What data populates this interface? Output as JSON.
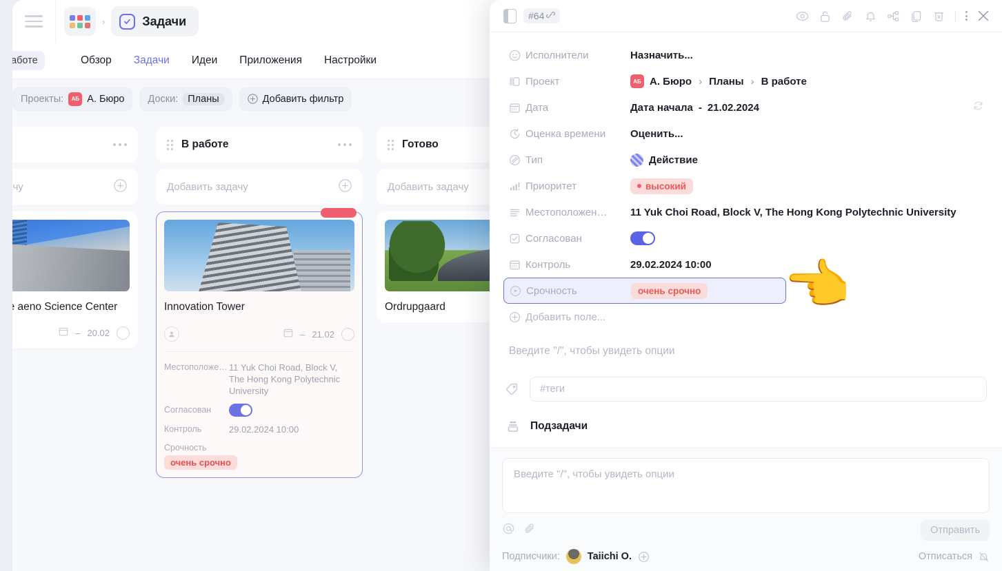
{
  "colors": {
    "accent": "#6b72e8",
    "danger": "#ef5f6e",
    "tag_bg": "#fbdcda",
    "tag_text": "#e0534f",
    "board_bg": "#f7f8fb",
    "muted": "#a8acbb"
  },
  "topbar": {
    "menu_icon": "hamburger-icon",
    "apps_icon": "apps-grid-icon",
    "apps_colors": [
      "#7b80e8",
      "#ef5f6e",
      "#57a8f0",
      "#f0bd6e",
      "#6fc79a",
      "#e3716e"
    ],
    "separator": "›",
    "breadcrumb_app": "Задачи",
    "check_icon": "check-circle-icon"
  },
  "nav": {
    "pill_label": "работе",
    "tabs": [
      {
        "label": "Обзор",
        "active": false
      },
      {
        "label": "Задачи",
        "active": true
      },
      {
        "label": "Идеи",
        "active": false
      },
      {
        "label": "Приложения",
        "active": false
      },
      {
        "label": "Настройки",
        "active": false
      }
    ]
  },
  "filters": {
    "projects_key": "Проекты:",
    "projects_avatar": "АБ",
    "projects_value": "А. Бюро",
    "boards_key": "Доски:",
    "boards_value": "Планы",
    "add_filter": "Добавить фильтр",
    "add_filter_icon": "plus-circle-icon"
  },
  "board": {
    "add_task_placeholder": "Добавить задачу",
    "add_task_placeholder_clipped": "чу",
    "columns": [
      {
        "title": "",
        "card": {
          "title": "маркетинговые\nаеno Science Center",
          "date": "20.02"
        }
      },
      {
        "title": "В работе",
        "card": {
          "title": "Innovation Tower",
          "date": "21.02",
          "fields": [
            {
              "key": "Местоположе…",
              "value": "11 Yuk Choi Road, Block V, The Hong Kong Polytechnic University",
              "type": "text"
            },
            {
              "key": "Согласован",
              "value": "on",
              "type": "toggle"
            },
            {
              "key": "Контроль",
              "value": "29.02.2024 10:00",
              "type": "text"
            },
            {
              "key": "Срочность",
              "value": "очень срочно",
              "type": "tag"
            }
          ]
        }
      },
      {
        "title": "Готово",
        "card": {
          "title": "Ordrupgaard",
          "date": ""
        }
      }
    ]
  },
  "panel": {
    "header": {
      "sidebar_icon": "panel-toggle-icon",
      "task_id": "#64",
      "link_icon": "link-icon",
      "actions": [
        "eye-icon",
        "lock-icon",
        "paperclip-icon",
        "bell-icon",
        "sitemap-icon",
        "copy-document-icon",
        "trash-icon"
      ],
      "kebab_icon": "more-vertical-icon",
      "close_icon": "close-icon"
    },
    "fields": [
      {
        "icon": "smiley-face-icon",
        "key": "Исполнители",
        "value": "Назначить...",
        "type": "placeholder"
      },
      {
        "icon": "project-board-icon",
        "key": "Проект",
        "type": "breadcrumb",
        "avatar": "АБ",
        "crumbs": [
          "А. Бюро",
          "Планы",
          "В работе"
        ],
        "crumb_sep": "›"
      },
      {
        "icon": "calendar-icon",
        "key": "Дата",
        "type": "date",
        "value_prefix": "Дата начала",
        "value_dash": "-",
        "value": "21.02.2024",
        "trailing_icon": "repeat-icon"
      },
      {
        "icon": "time-estimate-icon",
        "key": "Оценка времени",
        "value": "Оценить...",
        "type": "strong"
      },
      {
        "icon": "type-circle-icon",
        "key": "Тип",
        "value": "Действие",
        "type": "type"
      },
      {
        "icon": "priority-bars-icon",
        "key": "Приоритет",
        "value": "высокий",
        "type": "tag-dot"
      },
      {
        "icon": "text-lines-icon",
        "key": "Местоположен…",
        "value": "11 Yuk Choi Road, Block V, The Hong Kong Polytechnic University",
        "type": "strong"
      },
      {
        "icon": "checkbox-icon",
        "key": "Согласован",
        "value": "on",
        "type": "toggle"
      },
      {
        "icon": "calendar-icon",
        "key": "Контроль",
        "value": "29.02.2024 10:00",
        "type": "strong"
      },
      {
        "icon": "dropdown-circle-icon",
        "key": "Срочность",
        "value": "очень срочно",
        "type": "tag",
        "highlighted": true
      },
      {
        "icon": "plus-circle-icon",
        "key": "Добавить поле...",
        "value": "",
        "type": "add"
      }
    ],
    "pointer_emoji": "👈",
    "description_placeholder": "Введите \"/\", чтобы увидеть опции",
    "tags": {
      "icon": "tag-icon",
      "placeholder": "#теги",
      "value": ""
    },
    "subtasks": {
      "icon": "subtasks-icon",
      "label": "Подзадачи"
    },
    "footer": {
      "comment_placeholder": "Введите \"/\", чтобы увидеть опции",
      "mention_icon": "mention-icon",
      "attach_icon": "paperclip-icon",
      "send_label": "Отправить",
      "subscribers_label": "Подписчики:",
      "subscriber_name": "Taiichi O.",
      "add_subscriber_icon": "plus-circle-icon",
      "unsubscribe_label": "Отписаться",
      "unsubscribe_icon": "bell-off-icon"
    }
  }
}
